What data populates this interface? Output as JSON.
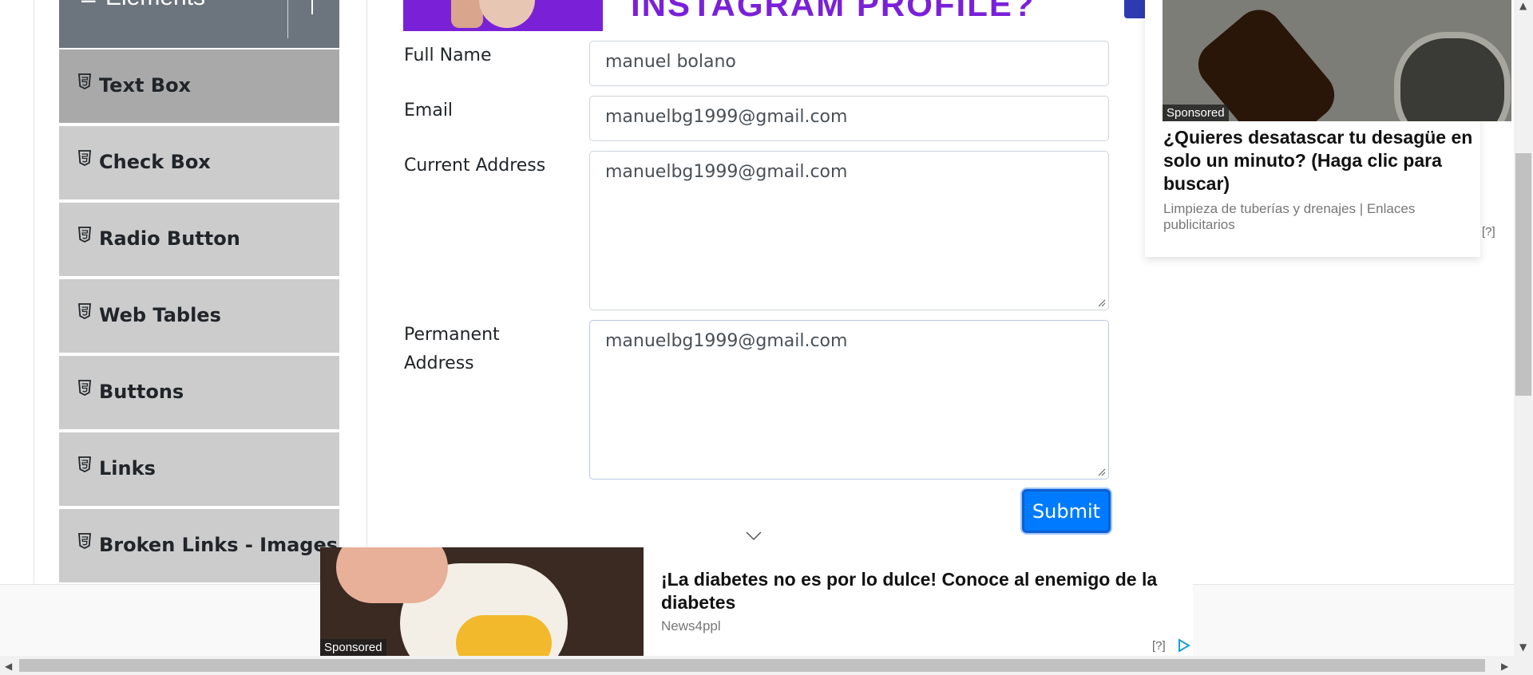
{
  "sidebar": {
    "group_title": "Elements",
    "items": [
      {
        "label": "Text Box",
        "active": true
      },
      {
        "label": "Check Box"
      },
      {
        "label": "Radio Button"
      },
      {
        "label": "Web Tables"
      },
      {
        "label": "Buttons"
      },
      {
        "label": "Links"
      },
      {
        "label": "Broken Links - Images"
      }
    ]
  },
  "banner": {
    "text": "INSTAGRAM PROFILE?"
  },
  "form": {
    "full_name_label": "Full Name",
    "full_name_value": "manuel bolano",
    "email_label": "Email",
    "email_value": "manuelbg1999@gmail.com",
    "current_address_label": "Current Address",
    "current_address_value": "manuelbg1999@gmail.com",
    "permanent_address_label_line1": "Permanent",
    "permanent_address_label_line2": "Address",
    "permanent_address_value": "manuelbg1999@gmail.com",
    "submit_label": "Submit"
  },
  "ad_right": {
    "sponsored": "Sponsored",
    "title": "¿Quieres desatascar tu desagüe en solo un minuto? (Haga clic para buscar)",
    "source": "Limpieza de tuberías y drenajes | Enlaces publicitarios",
    "help": "[?]"
  },
  "ad_bottom": {
    "sponsored": "Sponsored",
    "title": "¡La diabetes no es por lo dulce! Conoce al enemigo de la diabetes",
    "source": "News4ppl",
    "help": "[?]"
  },
  "colors": {
    "primary": "#007bff",
    "sidebar_bg": "#cccccc",
    "sidebar_active": "#a9a9a9",
    "group_header": "#6c757d"
  }
}
